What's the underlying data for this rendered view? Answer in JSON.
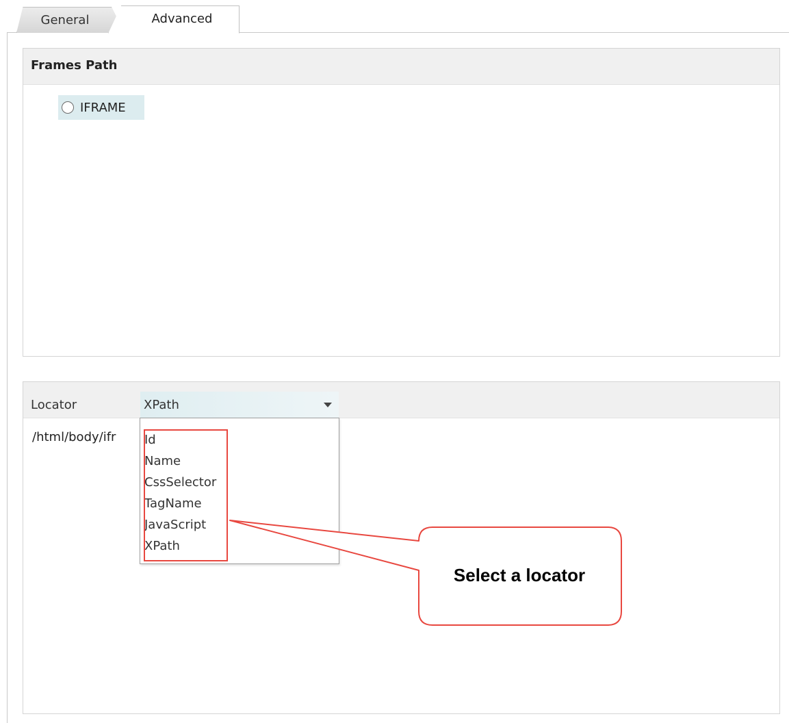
{
  "tabs": [
    {
      "label": "General",
      "active": false
    },
    {
      "label": "Advanced",
      "active": true
    }
  ],
  "frames_group": {
    "title": "Frames Path",
    "items": [
      {
        "label": "IFRAME",
        "selected": false
      }
    ]
  },
  "locator_group": {
    "label": "Locator",
    "selected_value": "XPath",
    "path_value": "/html/body/ifr",
    "options": [
      "Id",
      "Name",
      "CssSelector",
      "TagName",
      "JavaScript",
      "XPath"
    ]
  },
  "annotation": {
    "callout_text": "Select a locator",
    "highlight_color": "#e8473f"
  }
}
